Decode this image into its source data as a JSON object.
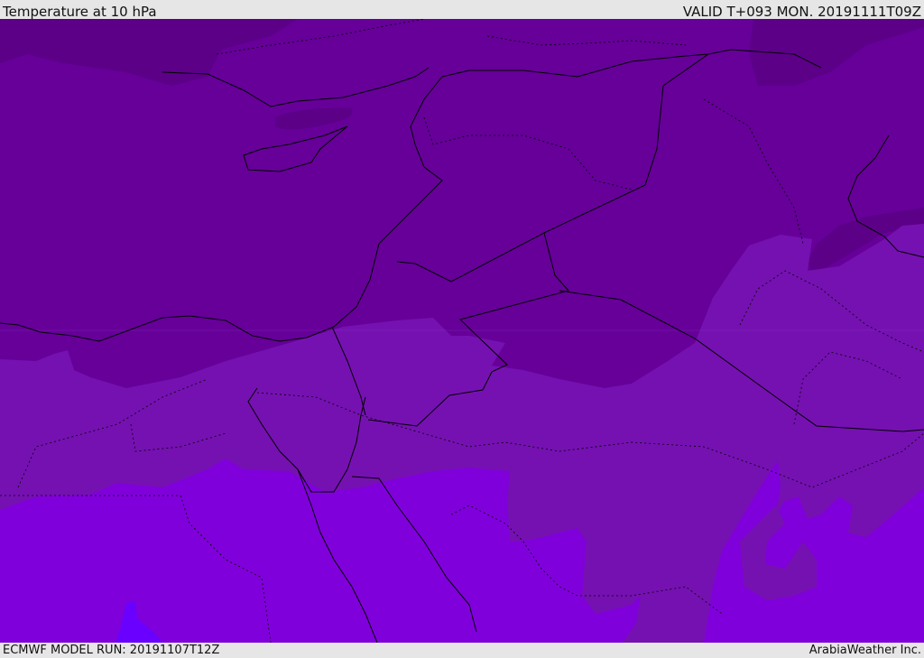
{
  "header": {
    "title": "Temperature at 10 hPa",
    "valid": "VALID T+093 MON. 20191111T09Z"
  },
  "footer": {
    "model_run": "ECMWF MODEL RUN: 20191107T12Z",
    "credit": "ArabiaWeather Inc."
  },
  "colors": {
    "darkest": "#5c0088",
    "dark": "#660099",
    "mid": "#7511b1",
    "bright": "#8000db",
    "blue": "#6a00ff",
    "border": "#000000"
  }
}
